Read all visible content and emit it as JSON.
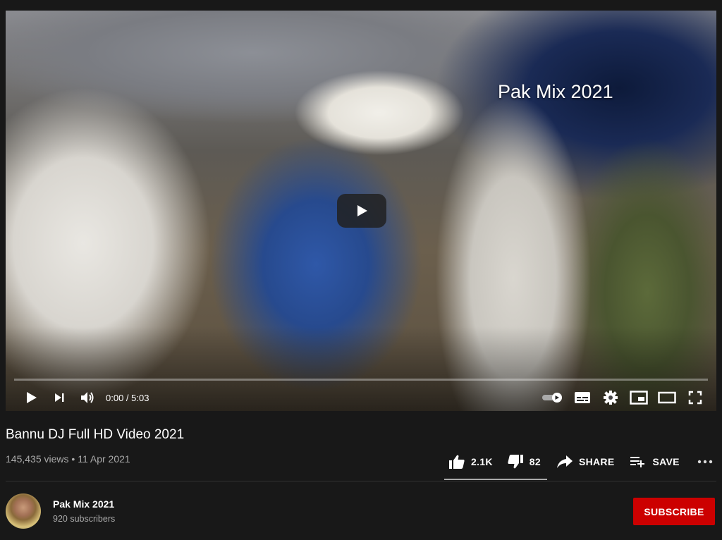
{
  "player": {
    "watermark": "Pak Mix 2021",
    "time_display": "0:00 / 5:03",
    "progress_fraction": 0.0
  },
  "video": {
    "title": "Bannu DJ Full HD Video 2021",
    "views": "145,435 views",
    "separator": "•",
    "date": "11 Apr 2021"
  },
  "actions": {
    "like_count": "2.1K",
    "dislike_count": "82",
    "share_label": "SHARE",
    "save_label": "SAVE"
  },
  "channel": {
    "name": "Pak Mix 2021",
    "subscribers": "920 subscribers",
    "subscribe_label": "SUBSCRIBE"
  },
  "colors": {
    "background": "#181818",
    "subscribe": "#cc0000",
    "secondary_text": "#aaaaaa"
  },
  "icons": [
    "play-icon",
    "next-icon",
    "volume-icon",
    "autoplay-toggle-icon",
    "subtitles-icon",
    "settings-icon",
    "miniplayer-icon",
    "theater-icon",
    "fullscreen-icon",
    "like-icon",
    "dislike-icon",
    "share-icon",
    "save-icon",
    "more-icon"
  ]
}
